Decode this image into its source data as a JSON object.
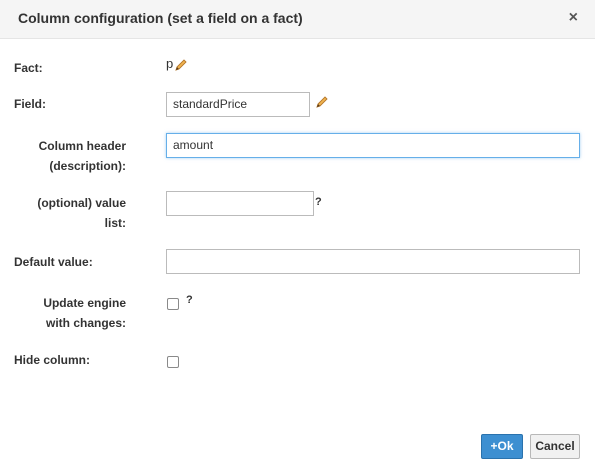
{
  "dialog": {
    "title": "Column configuration (set a field on a fact)",
    "close_glyph": "×"
  },
  "fields": {
    "fact": {
      "label": "Fact:",
      "value": "p",
      "edit_icon": "pencil-icon"
    },
    "field": {
      "label": "Field:",
      "value": "standardPrice",
      "edit_icon": "pencil-icon"
    },
    "column_header": {
      "label_line1": "Column header",
      "label_line2": "(description):",
      "value": "amount"
    },
    "value_list": {
      "label_line1": "(optional) value",
      "label_line2": "list:",
      "value": "",
      "help": "?"
    },
    "default_value": {
      "label": "Default value:",
      "value": ""
    },
    "update_engine": {
      "label_line1": "Update engine",
      "label_line2": "with changes:",
      "checked": false,
      "help": "?"
    },
    "hide_column": {
      "label": "Hide column:",
      "checked": false
    }
  },
  "buttons": {
    "ok_icon": "+",
    "ok_label": "Ok",
    "cancel_label": "Cancel"
  },
  "colors": {
    "primary_button": "#3d8fd1",
    "focus_border": "#66afe9",
    "pencil": "#e8a33d"
  }
}
